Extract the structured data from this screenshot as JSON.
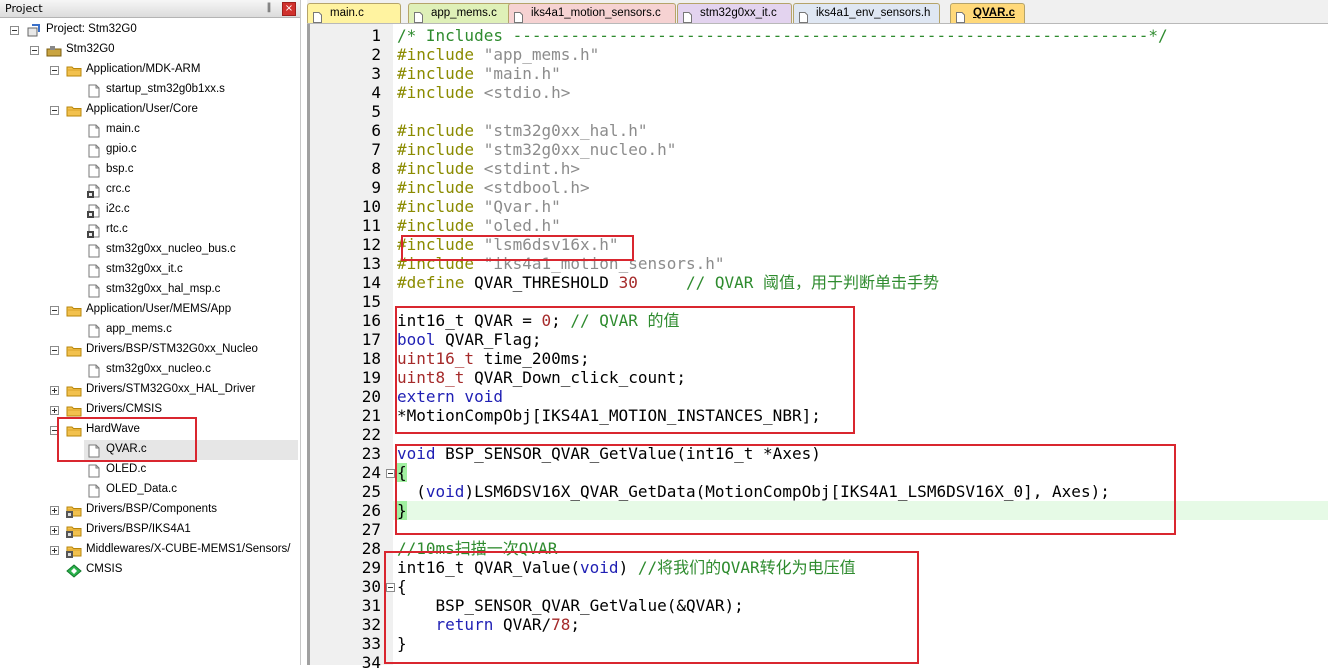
{
  "project_panel": {
    "title": "Project",
    "pin_glyph": "‖",
    "close_glyph": "×",
    "tree": [
      {
        "label": "Project: Stm32G0",
        "icon": "project-icon",
        "expander": "minus"
      },
      {
        "label": "Stm32G0",
        "icon": "target-icon",
        "expander": "minus"
      },
      {
        "label": "Application/MDK-ARM",
        "icon": "folder-icon",
        "expander": "minus"
      },
      {
        "label": "startup_stm32g0b1xx.s",
        "icon": "file-icon"
      },
      {
        "label": "Application/User/Core",
        "icon": "folder-icon",
        "expander": "minus"
      },
      {
        "label": "main.c",
        "icon": "file-icon"
      },
      {
        "label": "gpio.c",
        "icon": "file-icon"
      },
      {
        "label": "bsp.c",
        "icon": "file-icon"
      },
      {
        "label": "crc.c",
        "icon": "file-gear-icon"
      },
      {
        "label": "i2c.c",
        "icon": "file-gear-icon"
      },
      {
        "label": "rtc.c",
        "icon": "file-gear-icon"
      },
      {
        "label": "stm32g0xx_nucleo_bus.c",
        "icon": "file-icon"
      },
      {
        "label": "stm32g0xx_it.c",
        "icon": "file-icon"
      },
      {
        "label": "stm32g0xx_hal_msp.c",
        "icon": "file-icon"
      },
      {
        "label": "Application/User/MEMS/App",
        "icon": "folder-icon",
        "expander": "minus"
      },
      {
        "label": "app_mems.c",
        "icon": "file-icon"
      },
      {
        "label": "Drivers/BSP/STM32G0xx_Nucleo",
        "icon": "folder-icon",
        "expander": "minus"
      },
      {
        "label": "stm32g0xx_nucleo.c",
        "icon": "file-icon"
      },
      {
        "label": "Drivers/STM32G0xx_HAL_Driver",
        "icon": "folder-icon",
        "expander": "plus"
      },
      {
        "label": "Drivers/CMSIS",
        "icon": "folder-icon",
        "expander": "plus"
      },
      {
        "label": "HardWave",
        "icon": "folder-icon",
        "expander": "minus"
      },
      {
        "label": "QVAR.c",
        "icon": "file-icon",
        "selected": true
      },
      {
        "label": "OLED.c",
        "icon": "file-icon"
      },
      {
        "label": "OLED_Data.c",
        "icon": "file-icon"
      },
      {
        "label": "Drivers/BSP/Components",
        "icon": "folder-gear-icon",
        "expander": "plus"
      },
      {
        "label": "Drivers/BSP/IKS4A1",
        "icon": "folder-gear-icon",
        "expander": "plus"
      },
      {
        "label": "Middlewares/X-CUBE-MEMS1/Sensors/",
        "icon": "folder-gear-icon",
        "expander": "plus"
      },
      {
        "label": "CMSIS",
        "icon": "cmsis-diamond-icon"
      }
    ]
  },
  "tabs": [
    {
      "label": "main.c",
      "color": "#fff3a0",
      "icon": "file-icon"
    },
    {
      "label": "app_mems.c",
      "color": "#dff0b8",
      "icon": "file-icon"
    },
    {
      "label": "iks4a1_motion_sensors.c",
      "color": "#f6d2d2",
      "icon": "file-gear-icon"
    },
    {
      "label": "stm32g0xx_it.c",
      "color": "#e3d3ef",
      "icon": "file-icon"
    },
    {
      "label": "iks4a1_env_sensors.h",
      "color": "#dfe7f3",
      "icon": "file-icon"
    },
    {
      "label": "QVAR.c",
      "color": "#ffd97a",
      "icon": "file-icon",
      "active": true
    }
  ],
  "code_lines": [
    {
      "n": "1",
      "segs": [
        {
          "t": "/* Includes ------------------------------------------------------------------*/",
          "c": "com"
        }
      ]
    },
    {
      "n": "2",
      "segs": [
        {
          "t": "#include ",
          "c": "dir"
        },
        {
          "t": "\"app_mems.h\"",
          "c": "str"
        }
      ]
    },
    {
      "n": "3",
      "segs": [
        {
          "t": "#include ",
          "c": "dir"
        },
        {
          "t": "\"main.h\"",
          "c": "str"
        }
      ]
    },
    {
      "n": "4",
      "segs": [
        {
          "t": "#include ",
          "c": "dir"
        },
        {
          "t": "<stdio.h>",
          "c": "str"
        }
      ]
    },
    {
      "n": "5",
      "segs": []
    },
    {
      "n": "6",
      "segs": [
        {
          "t": "#include ",
          "c": "dir"
        },
        {
          "t": "\"stm32g0xx_hal.h\"",
          "c": "str"
        }
      ]
    },
    {
      "n": "7",
      "segs": [
        {
          "t": "#include ",
          "c": "dir"
        },
        {
          "t": "\"stm32g0xx_nucleo.h\"",
          "c": "str"
        }
      ]
    },
    {
      "n": "8",
      "segs": [
        {
          "t": "#include ",
          "c": "dir"
        },
        {
          "t": "<stdint.h>",
          "c": "str"
        }
      ]
    },
    {
      "n": "9",
      "segs": [
        {
          "t": "#include ",
          "c": "dir"
        },
        {
          "t": "<stdbool.h>",
          "c": "str"
        }
      ]
    },
    {
      "n": "10",
      "segs": [
        {
          "t": "#include ",
          "c": "dir"
        },
        {
          "t": "\"Qvar.h\"",
          "c": "str"
        }
      ]
    },
    {
      "n": "11",
      "segs": [
        {
          "t": "#include ",
          "c": "dir"
        },
        {
          "t": "\"oled.h\"",
          "c": "str"
        }
      ]
    },
    {
      "n": "12",
      "segs": [
        {
          "t": "#include ",
          "c": "dir"
        },
        {
          "t": "\"lsm6dsv16x.h\"",
          "c": "str"
        }
      ]
    },
    {
      "n": "13",
      "segs": [
        {
          "t": "#include ",
          "c": "dir"
        },
        {
          "t": "\"iks4a1_motion_sensors.h\"",
          "c": "str"
        }
      ]
    },
    {
      "n": "14",
      "segs": [
        {
          "t": "#define ",
          "c": "dir"
        },
        {
          "t": "QVAR_THRESHOLD ",
          "c": ""
        },
        {
          "t": "30",
          "c": "num"
        },
        {
          "t": "     // QVAR 阈值，用于判断单击手势",
          "c": "com"
        }
      ]
    },
    {
      "n": "15",
      "segs": []
    },
    {
      "n": "16",
      "segs": [
        {
          "t": "int16_t QVAR = ",
          "c": ""
        },
        {
          "t": "0",
          "c": "num"
        },
        {
          "t": "; ",
          "c": ""
        },
        {
          "t": "// QVAR 的值",
          "c": "com"
        }
      ]
    },
    {
      "n": "17",
      "segs": [
        {
          "t": "bool",
          "c": "kw"
        },
        {
          "t": " QVAR_Flag;",
          "c": ""
        }
      ]
    },
    {
      "n": "18",
      "segs": [
        {
          "t": "uint16_t",
          "c": "num"
        },
        {
          "t": " time_200ms;",
          "c": ""
        }
      ]
    },
    {
      "n": "19",
      "segs": [
        {
          "t": "uint8_t",
          "c": "num"
        },
        {
          "t": " QVAR_Down_click_count;",
          "c": ""
        }
      ]
    },
    {
      "n": "20",
      "segs": [
        {
          "t": "extern void",
          "c": "kw"
        }
      ]
    },
    {
      "n": "21",
      "segs": [
        {
          "t": "*MotionCompObj[IKS4A1_MOTION_INSTANCES_NBR];",
          "c": ""
        }
      ]
    },
    {
      "n": "22",
      "segs": []
    },
    {
      "n": "23",
      "segs": [
        {
          "t": "void",
          "c": "kw"
        },
        {
          "t": " BSP_SENSOR_QVAR_GetValue(int16_t *Axes)",
          "c": ""
        }
      ]
    },
    {
      "n": "24",
      "segs": [
        {
          "t": "{",
          "c": "brace"
        }
      ],
      "fold": true
    },
    {
      "n": "25",
      "segs": [
        {
          "t": "  (",
          "c": ""
        },
        {
          "t": "void",
          "c": "kw"
        },
        {
          "t": ")LSM6DSV16X_QVAR_GetData(MotionCompObj[IKS4A1_LSM6DSV16X_0], Axes);",
          "c": ""
        }
      ]
    },
    {
      "n": "26",
      "segs": [
        {
          "t": "}",
          "c": "brace"
        }
      ],
      "highlight": true
    },
    {
      "n": "27",
      "segs": []
    },
    {
      "n": "28",
      "segs": [
        {
          "t": "//10ms扫描一次QVAR",
          "c": "com"
        }
      ]
    },
    {
      "n": "29",
      "segs": [
        {
          "t": "int16_t QVAR_Value(",
          "c": ""
        },
        {
          "t": "void",
          "c": "kw"
        },
        {
          "t": ") ",
          "c": ""
        },
        {
          "t": "//将我们的QVAR转化为电压值",
          "c": "com"
        }
      ]
    },
    {
      "n": "30",
      "segs": [
        {
          "t": "{",
          "c": ""
        }
      ],
      "fold": true
    },
    {
      "n": "31",
      "segs": [
        {
          "t": "    BSP_SENSOR_QVAR_GetValue(&QVAR);",
          "c": ""
        }
      ]
    },
    {
      "n": "32",
      "segs": [
        {
          "t": "    ",
          "c": ""
        },
        {
          "t": "return",
          "c": "kw"
        },
        {
          "t": " QVAR/",
          "c": ""
        },
        {
          "t": "78",
          "c": "num"
        },
        {
          "t": ";",
          "c": ""
        }
      ]
    },
    {
      "n": "33",
      "segs": [
        {
          "t": "}",
          "c": ""
        }
      ]
    },
    {
      "n": "34",
      "segs": []
    }
  ],
  "colors": {
    "annotation_red": "#d9262f",
    "current_line_green": "#e6fae6",
    "comment_green": "#2e8b2e",
    "keyword_blue": "#1f1fb4",
    "directive_olive": "#8b8b00"
  }
}
